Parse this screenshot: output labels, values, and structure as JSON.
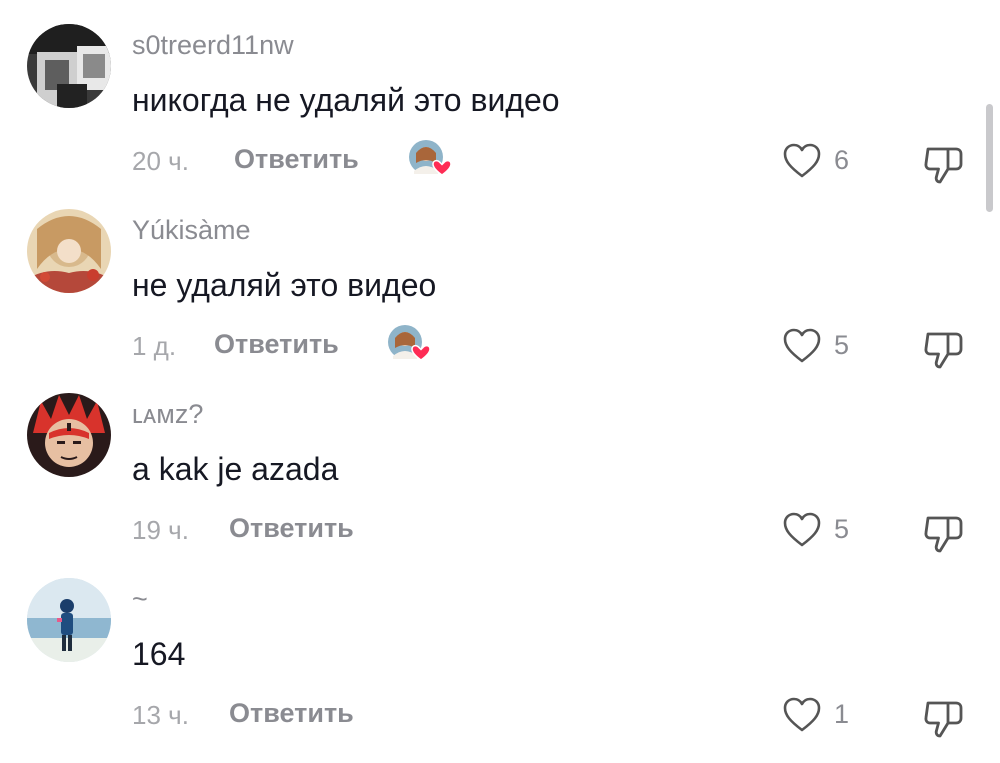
{
  "comments": [
    {
      "username": "s0treerd11nw",
      "text": "никогда не удаляй это видео",
      "time": "20 ч.",
      "reply_label": "Ответить",
      "creator_liked": true,
      "likes": "6",
      "avatar_icon": "avatar-photo"
    },
    {
      "username": "Yúkisàme",
      "text": "не удаляй это видео",
      "time": "1 д.",
      "reply_label": "Ответить",
      "creator_liked": true,
      "likes": "5",
      "avatar_icon": "avatar-photo"
    },
    {
      "username": "ʟᴀᴍᴢ?",
      "text": "a kak je azada",
      "time": "19 ч.",
      "reply_label": "Ответить",
      "creator_liked": false,
      "likes": "5",
      "avatar_icon": "avatar-photo"
    },
    {
      "username": "~",
      "text": "164",
      "time": "13 ч.",
      "reply_label": "Ответить",
      "creator_liked": false,
      "likes": "1",
      "avatar_icon": "avatar-photo"
    }
  ],
  "icons": {
    "like": "heart-outline-icon",
    "dislike": "thumbs-down-icon",
    "creator_like": "creator-liked-heart-icon"
  },
  "colors": {
    "text": "#161823",
    "secondary": "#8a8b91",
    "timestamp": "#a6a7ab",
    "heart_badge": "#fe2c55"
  }
}
